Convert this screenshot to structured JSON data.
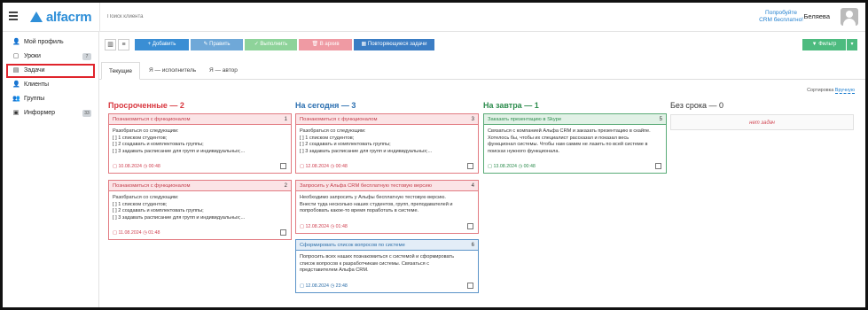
{
  "header": {
    "logo_text": "alfacrm",
    "search_placeholder": "Поиск клиента",
    "promo_line1": "Попробуйте",
    "promo_line2": "CRM бесплатно!",
    "user_name": "Беляева"
  },
  "sidebar": {
    "items": [
      {
        "label": "Мой профиль",
        "icon": "user-icon",
        "count": ""
      },
      {
        "label": "Уроки",
        "icon": "calendar-icon",
        "count": "7"
      },
      {
        "label": "Задачи",
        "icon": "tasks-icon",
        "count": ""
      },
      {
        "label": "Клиенты",
        "icon": "user-icon",
        "count": ""
      },
      {
        "label": "Группы",
        "icon": "users-icon",
        "count": ""
      },
      {
        "label": "Информер",
        "icon": "news-icon",
        "count": "33"
      }
    ]
  },
  "toolbar": {
    "add": "+ Добавить",
    "edit": "✎ Править",
    "complete": "✓ Выполнить",
    "archive": "🗑 В архив",
    "recurring": "▦ Повторяющиеся задачи",
    "filter": "▼ Фильтр",
    "colors": {
      "add": "#3a8ed4",
      "edit": "#6fa8d8",
      "complete": "#8ed39a",
      "archive": "#ef9aa3",
      "recurring": "#3b7dc4",
      "filter": "#4dbb7f"
    }
  },
  "tabs": [
    "Текущие",
    "Я — исполнитель",
    "Я — автор"
  ],
  "sort": {
    "label": "Сортировка",
    "value": "Вручную"
  },
  "columns": {
    "overdue": {
      "title": "Просроченные — 2",
      "color": "#d8373f"
    },
    "today": {
      "title": "На сегодня — 3",
      "color": "#2b6fb0"
    },
    "tomorrow": {
      "title": "На завтра — 1",
      "color": "#2c8c4d"
    },
    "nodue": {
      "title": "Без срока — 0",
      "color": "#333333",
      "empty": "нет задач"
    }
  },
  "cards": {
    "c1": {
      "title": "Познакомиться с функционалом",
      "num": "1",
      "lines": [
        "Разобраться со следующим:",
        "[ ] 1 списком студентов;",
        "[ ] 2 создавать и комплектовать группы;",
        "[ ] 3 задавать расписание для групп и индивидуальных;..."
      ],
      "date": "10.08.2024",
      "time": "00:48"
    },
    "c2": {
      "title": "Познакомиться с функционалом",
      "num": "2",
      "lines": [
        "Разобраться со следующим:",
        "[ ] 1 списком студентов;",
        "[ ] 2 создавать и комплектовать группы;",
        "[ ] 3 задавать расписание для групп и индивидуальных;..."
      ],
      "date": "11.08.2024",
      "time": "01:48"
    },
    "c3": {
      "title": "Познакомиться с функционалом",
      "num": "3",
      "lines": [
        "Разобраться со следующим:",
        "[ ] 1 списком студентов;",
        "[ ] 2 создавать и комплектовать группы;",
        "[ ] 3 задавать расписание для групп и индивидуальных;..."
      ],
      "date": "12.08.2024",
      "time": "00:48"
    },
    "c4": {
      "title": "Запросить у Альфа CRM бесплатную тестовую версию",
      "num": "4",
      "lines": [
        "Необходимо запросить у Альфы бесплатную тестовую версию.",
        "Внести туда несколько наших студентов, групп, преподавателей и",
        "попробовать какое-то время поработать в системе."
      ],
      "date": "12.08.2024",
      "time": "01:48"
    },
    "c5": {
      "title": "Заказать презентацию в Skype",
      "num": "5",
      "lines": [
        "Связаться с компанией Альфа CRM и заказать презентацию в скайпе.",
        "Хотелось бы, чтобы их специалист рассказал и показал весь",
        "функционал системы. Чтобы нам самим не лазить по всей системе в",
        "поисках нужного функционала."
      ],
      "date": "13.08.2024",
      "time": "00:48"
    },
    "c6": {
      "title": "Сформировать список вопросов по системе",
      "num": "6",
      "lines": [
        "Попросить всех наших познакомиться с системой и сформировать",
        "список вопросов к разработчикам системы. Связаться с",
        "представителем Альфа CRM."
      ],
      "date": "12.08.2024",
      "time": "23:48"
    }
  }
}
